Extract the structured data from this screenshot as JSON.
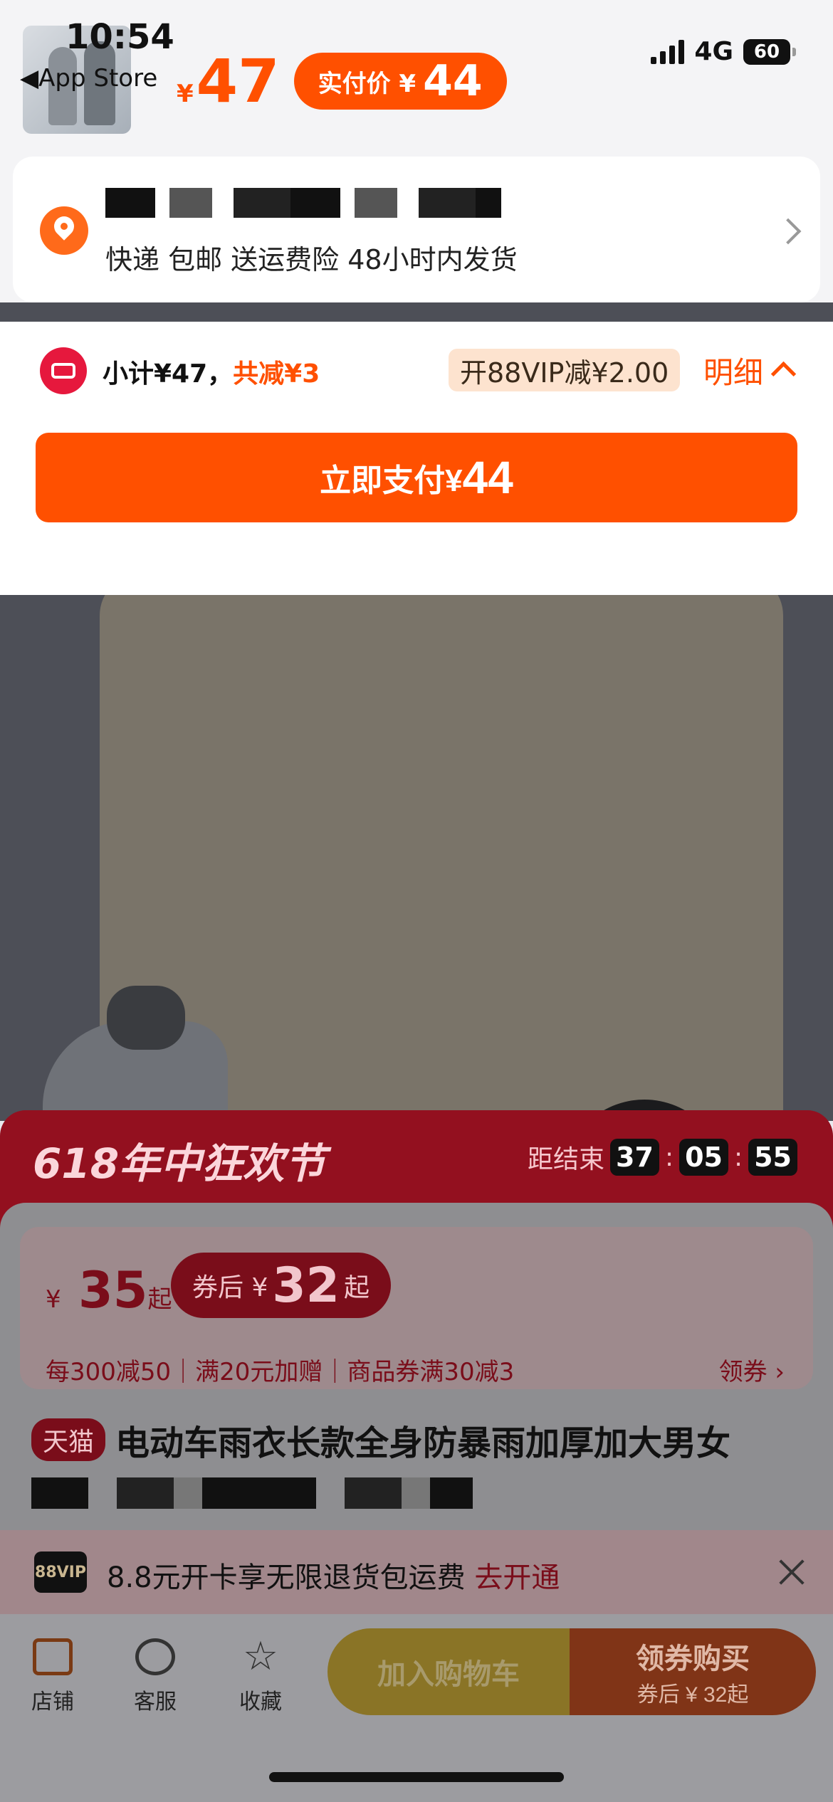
{
  "status": {
    "time": "10:54",
    "back_app": "App Store",
    "network": "4G",
    "battery": "60"
  },
  "order": {
    "price_symbol": "¥",
    "price": "47",
    "pay_label": "实付价 ¥",
    "pay_value": "44"
  },
  "address": {
    "delivery": "快递 包邮 送运费险 48小时内发货"
  },
  "payment": {
    "subtotal_prefix": "小计¥47，",
    "subtotal_discount": "共减¥3",
    "vip_offer": "开88VIP减¥2.00",
    "detail_label": "明细",
    "pay_button_prefix": "立即支付¥",
    "pay_button_amount": "44"
  },
  "promo": {
    "title": "618年中狂欢节",
    "countdown_label": "距结束",
    "countdown": [
      "37",
      "05",
      "55"
    ]
  },
  "product": {
    "price_symbol": "¥",
    "price": "35",
    "price_suffix": "起",
    "coupon_prefix": "券后 ¥",
    "coupon_price": "32",
    "coupon_suffix": "起",
    "rules": "每300减50｜满20元加赠｜商品券满30减3",
    "get_coupon": "领券",
    "tag": "天猫",
    "title": "电动车雨衣长款全身防暴雨加厚加大男女"
  },
  "vip_bar": {
    "badge": "88VIP",
    "text": "8.8元开卡享无限退货包运费",
    "link": "去开通"
  },
  "bottom": {
    "tabs": [
      {
        "label": "店铺"
      },
      {
        "label": "客服"
      },
      {
        "label": "收藏"
      }
    ],
    "add_cart": "加入购物车",
    "buy_line1": "领券购买",
    "buy_line2": "券后 ¥ 32起"
  },
  "colors": {
    "accent": "#ff5000",
    "promo_red": "#e6183d"
  }
}
